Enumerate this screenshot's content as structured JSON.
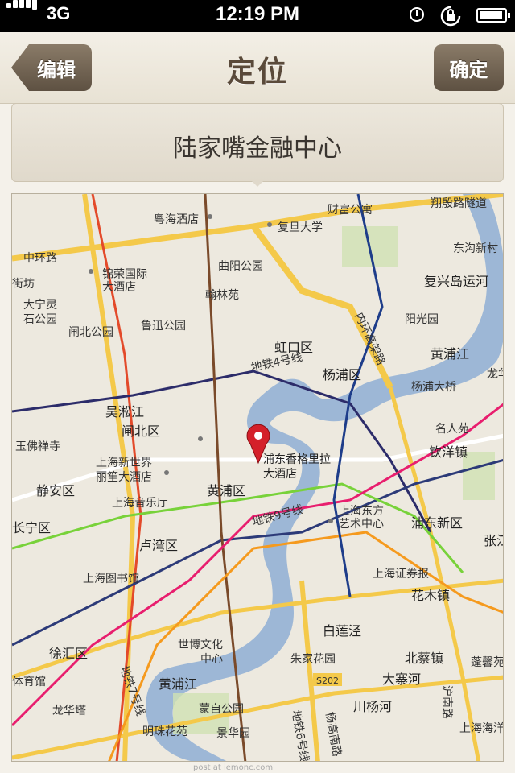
{
  "status_bar": {
    "network": "3G",
    "time": "12:19 PM"
  },
  "nav": {
    "title": "定位",
    "back_label": "编辑",
    "done_label": "确定"
  },
  "location": {
    "name": "陆家嘴金融中心"
  },
  "map": {
    "labels": {
      "huanhuan": "中环路",
      "tongguo": "翔殷路隧道",
      "dongshen": "东沟新村",
      "fuxing": "复兴岛运河",
      "cai": "财富公寓",
      "yuehai": "粤海酒店",
      "fudan": "复旦大学",
      "jinrong": "锦荣国际",
      "jinrong2": "大酒店",
      "quyang": "曲阳公园",
      "hanlin": "翰林苑",
      "dananling": "大宁灵",
      "dananling2": "石公园",
      "zhabei": "闸北公园",
      "luxun": "鲁迅公园",
      "hongkou": "虹口区",
      "neihuan": "内环高架路",
      "yangguang": "阳光园",
      "huangpujiang": "黄浦江",
      "yangpu": "杨浦区",
      "yangpudaqiao": "杨浦大桥",
      "line4": "地铁4号线",
      "wusong": "吴淞江",
      "zhabeiqu": "闸北区",
      "yufo": "玉佛禅寺",
      "xinshijie": "上海新世界",
      "xinshijie2": "丽笙大酒店",
      "jingan": "静安区",
      "yinyue": "上海音乐厅",
      "huangpu": "黄浦区",
      "shangrila": "浦东香格里拉",
      "shangrila2": "大酒店",
      "line9": "地铁9号线",
      "dongfang": "上海东方",
      "dongfang2": "艺术中心",
      "pudong": "浦东新区",
      "changning": "长宁区",
      "luwan": "卢湾区",
      "library": "上海图书馆",
      "zhengquan": "上海证券报",
      "huamu": "花木镇",
      "xuhui": "徐汇区",
      "bolian": "白莲泾",
      "shibo": "世博文化",
      "shibo2": "中心",
      "zhujia": "朱家花园",
      "beicai": "北蔡镇",
      "dazhaihe": "大寨河",
      "line7": "地铁7号线",
      "huangpujiang2": "黄浦江",
      "s202": "S202",
      "huanan": "沪南路",
      "longhua": "龙华塔",
      "menglu": "蒙自公园",
      "chuanyang": "川杨河",
      "mingzhu": "明珠花苑",
      "jinghua": "景华园",
      "line6": "地铁6号线",
      "yanggao": "杨高南路",
      "mingren": "名人苑",
      "qinyang": "钦洋镇",
      "zhangjiang": "张江",
      "pengcun": "蓬馨苑",
      "shanghaixue": "上海海洋",
      "jinfang": "街坊",
      "longhua2": "龙华",
      "tiyu": "体育馆"
    },
    "pin": {
      "label_line1": "浦东香格里拉",
      "label_line2": "大酒店"
    }
  },
  "footer": {
    "credits": "post at iemonc.com"
  }
}
